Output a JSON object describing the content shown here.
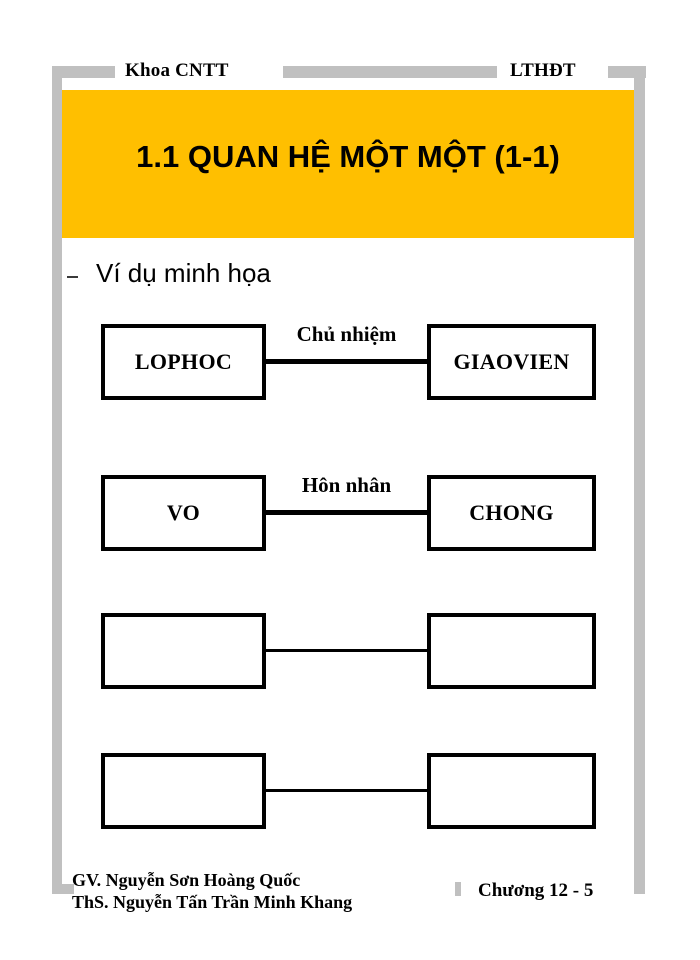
{
  "slide": {
    "header": {
      "left_label": "Khoa CNTT",
      "right_label": "LTHĐT"
    },
    "title": "1.1 QUAN HỆ MỘT MỘT (1-1)",
    "bullet": {
      "marker": "dash",
      "text": "Ví dụ minh họa"
    },
    "relations": [
      {
        "left_entity": "LOPHOC",
        "relation_label": "Chủ nhiệm",
        "right_entity": "GIAOVIEN"
      },
      {
        "left_entity": "VO",
        "relation_label": "Hôn nhân",
        "right_entity": "CHONG"
      },
      {
        "left_entity": "",
        "relation_label": "",
        "right_entity": ""
      },
      {
        "left_entity": "",
        "relation_label": "",
        "right_entity": ""
      }
    ],
    "footer": {
      "author_line1": "GV. Nguyễn Sơn Hoàng Quốc",
      "author_line2": "ThS. Nguyễn Tấn Trần Minh Khang",
      "page_label": "Chương 12 - 5"
    },
    "colors": {
      "banner": "#ffbf00",
      "rail": "#c0c0c0",
      "text": "#000000",
      "background": "#ffffff"
    }
  }
}
